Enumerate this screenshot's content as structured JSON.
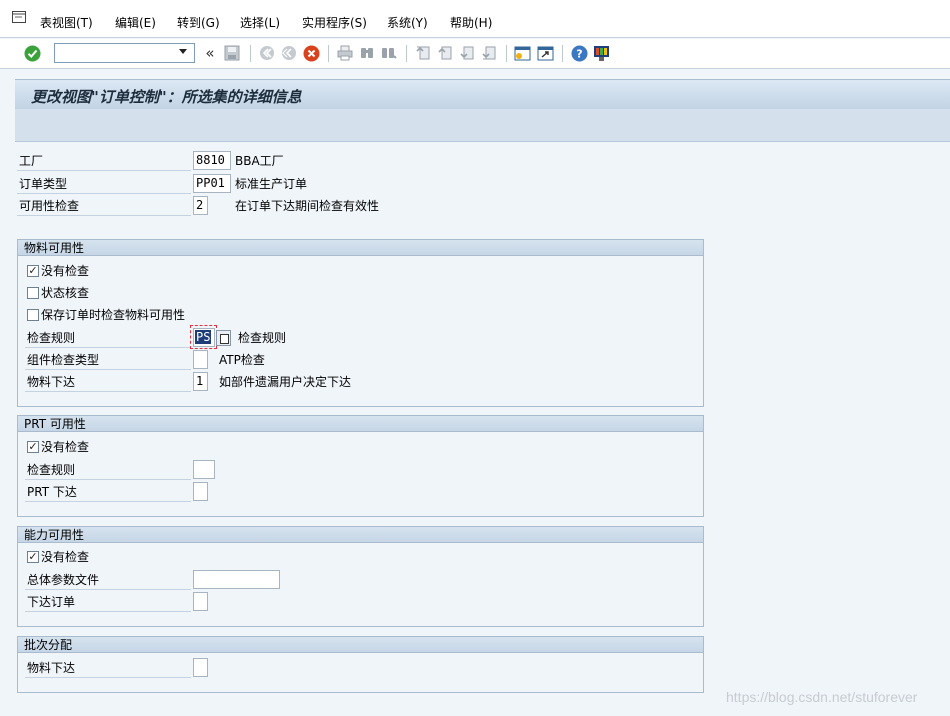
{
  "menu": {
    "items": [
      "表视图(T)",
      "编辑(E)",
      "转到(G)",
      "选择(L)",
      "实用程序(S)",
      "系统(Y)",
      "帮助(H)"
    ]
  },
  "toolbar": {
    "command_value": "",
    "icons": [
      "enter-icon",
      "command-field",
      "back-double-icon",
      "save-icon",
      "back-icon",
      "exit-icon",
      "cancel-icon",
      "print-icon",
      "find-icon",
      "find-next-icon",
      "first-page-icon",
      "prev-page-icon",
      "next-page-icon",
      "last-page-icon",
      "new-session-icon",
      "shortcut-icon",
      "help-icon",
      "customize-layout-icon"
    ],
    "cancel_color": "#d9421c",
    "enter_color": "#3ba23b"
  },
  "title": "更改视图\"订单控制\"：所选集的详细信息",
  "header_fields": {
    "plant": {
      "label": "工厂",
      "value": "8810",
      "desc": "BBA工厂"
    },
    "order_type": {
      "label": "订单类型",
      "value": "PP01",
      "desc": "标准生产订单"
    },
    "availability_check": {
      "label": "可用性检查",
      "value": "2",
      "desc": "在订单下达期间检查有效性"
    }
  },
  "groups": {
    "material": {
      "title": "物料可用性",
      "no_check": {
        "label": "没有检查",
        "checked": true
      },
      "status_check": {
        "label": "状态核查",
        "checked": false
      },
      "check_on_save": {
        "label": "保存订单时检查物料可用性",
        "checked": false
      },
      "checking_rule": {
        "label": "检查规则",
        "value": "PS",
        "desc": "检查规则"
      },
      "component_check_type": {
        "label": "组件检查类型",
        "value": "",
        "desc": "ATP检查"
      },
      "release": {
        "label": "物料下达",
        "value": "1",
        "desc": "如部件遗漏用户决定下达"
      }
    },
    "prt": {
      "title": "PRT 可用性",
      "no_check": {
        "label": "没有检查",
        "checked": true
      },
      "checking_rule": {
        "label": "检查规则",
        "value": ""
      },
      "release": {
        "label": "PRT 下达",
        "value": ""
      }
    },
    "capacity": {
      "title": "能力可用性",
      "no_check": {
        "label": "没有检查",
        "checked": true
      },
      "overall_profile": {
        "label": "总体参数文件",
        "value": ""
      },
      "release_order": {
        "label": "下达订单",
        "value": ""
      }
    },
    "batch": {
      "title": "批次分配",
      "release": {
        "label": "物料下达",
        "value": ""
      }
    }
  },
  "watermark": "https://blog.csdn.net/stuforever"
}
